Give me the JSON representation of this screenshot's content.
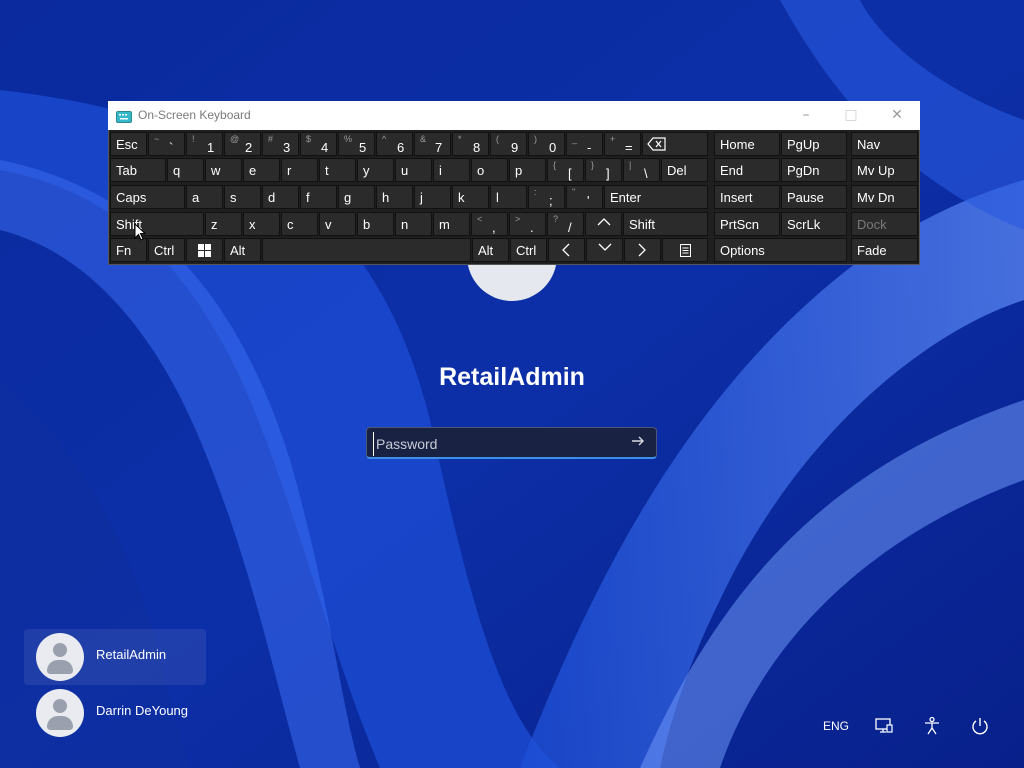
{
  "osk": {
    "title": "On-Screen Keyboard",
    "window_controls": {
      "minimize": "–",
      "maximize": "□",
      "close": "✕"
    },
    "keys": {
      "esc": "Esc",
      "tab": "Tab",
      "caps": "Caps",
      "shift": "Shift",
      "fn": "Fn",
      "ctrl": "Ctrl",
      "alt": "Alt",
      "del": "Del",
      "enter": "Enter",
      "shift_r": "Shift",
      "alt_r": "Alt",
      "ctrl_r": "Ctrl",
      "home": "Home",
      "pgup": "PgUp",
      "nav": "Nav",
      "end": "End",
      "pgdn": "PgDn",
      "mvup": "Mv Up",
      "insert": "Insert",
      "pause": "Pause",
      "mvdn": "Mv Dn",
      "prtscn": "PrtScn",
      "scrlk": "ScrLk",
      "dock": "Dock",
      "options": "Options",
      "fade": "Fade"
    },
    "number_row": [
      {
        "top": "~",
        "bot": "`"
      },
      {
        "top": "!",
        "bot": "1"
      },
      {
        "top": "@",
        "bot": "2"
      },
      {
        "top": "#",
        "bot": "3"
      },
      {
        "top": "$",
        "bot": "4"
      },
      {
        "top": "%",
        "bot": "5"
      },
      {
        "top": "^",
        "bot": "6"
      },
      {
        "top": "&",
        "bot": "7"
      },
      {
        "top": "*",
        "bot": "8"
      },
      {
        "top": "(",
        "bot": "9"
      },
      {
        "top": ")",
        "bot": "0"
      },
      {
        "top": "_",
        "bot": "-"
      },
      {
        "top": "+",
        "bot": "="
      }
    ],
    "row_q": [
      "q",
      "w",
      "e",
      "r",
      "t",
      "y",
      "u",
      "i",
      "o",
      "p"
    ],
    "row_q_sym": [
      {
        "top": "{",
        "bot": "["
      },
      {
        "top": "}",
        "bot": "]"
      },
      {
        "top": "|",
        "bot": "\\"
      }
    ],
    "row_a": [
      "a",
      "s",
      "d",
      "f",
      "g",
      "h",
      "j",
      "k",
      "l"
    ],
    "row_a_sym": [
      {
        "top": ":",
        "bot": ";"
      },
      {
        "top": "\"",
        "bot": "'"
      }
    ],
    "row_z": [
      "z",
      "x",
      "c",
      "v",
      "b",
      "n",
      "m"
    ],
    "row_z_sym": [
      {
        "top": "<",
        "bot": ","
      },
      {
        "top": ">",
        "bot": "."
      },
      {
        "top": "?",
        "bot": "/"
      }
    ]
  },
  "login": {
    "username": "RetailAdmin",
    "password_placeholder": "Password"
  },
  "users": [
    {
      "name": "RetailAdmin"
    },
    {
      "name": "Darrin DeYoung"
    }
  ],
  "tray": {
    "language": "ENG"
  }
}
